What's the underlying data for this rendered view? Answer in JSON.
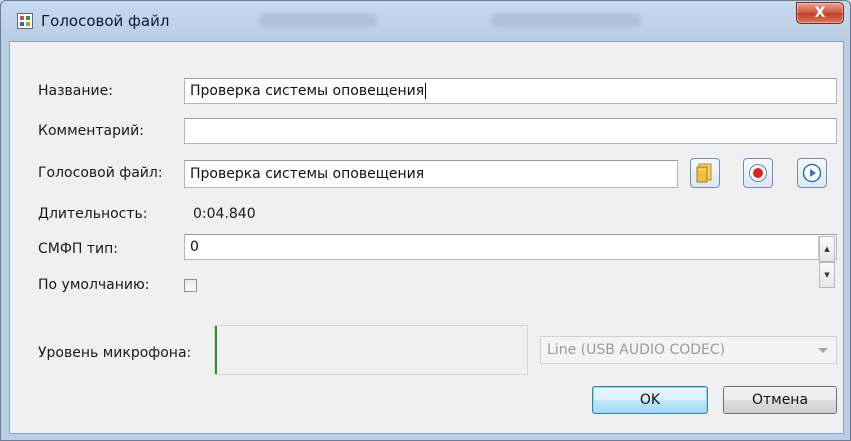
{
  "window": {
    "title": "Голосовой файл",
    "close_glyph": "X",
    "icon": "dialog-app-icon"
  },
  "form": {
    "name_label": "Название:",
    "name_value": "Проверка системы оповещения",
    "comment_label": "Комментарий:",
    "comment_value": "",
    "voice_file_label": "Голосовой файл:",
    "voice_file_value": "Проверка системы оповещения",
    "duration_label": "Длительность:",
    "duration_value": "0:04.840",
    "smfp_type_label": "СМФП тип:",
    "smfp_type_value": "0",
    "default_label": "По умолчанию:",
    "default_checked": false,
    "mic_level_label": "Уровень микрофона:",
    "mic_source_value": "Line (USB AUDIO  CODEC)"
  },
  "toolbar_icons": {
    "open": "open-file-icon",
    "record": "record-icon",
    "play": "play-icon"
  },
  "buttons": {
    "ok_label": "OK",
    "cancel_label": "Отмена"
  },
  "colors": {
    "record_red": "#e02020",
    "play_blue": "#2a73c8",
    "meter_green": "#2e8b2e"
  }
}
